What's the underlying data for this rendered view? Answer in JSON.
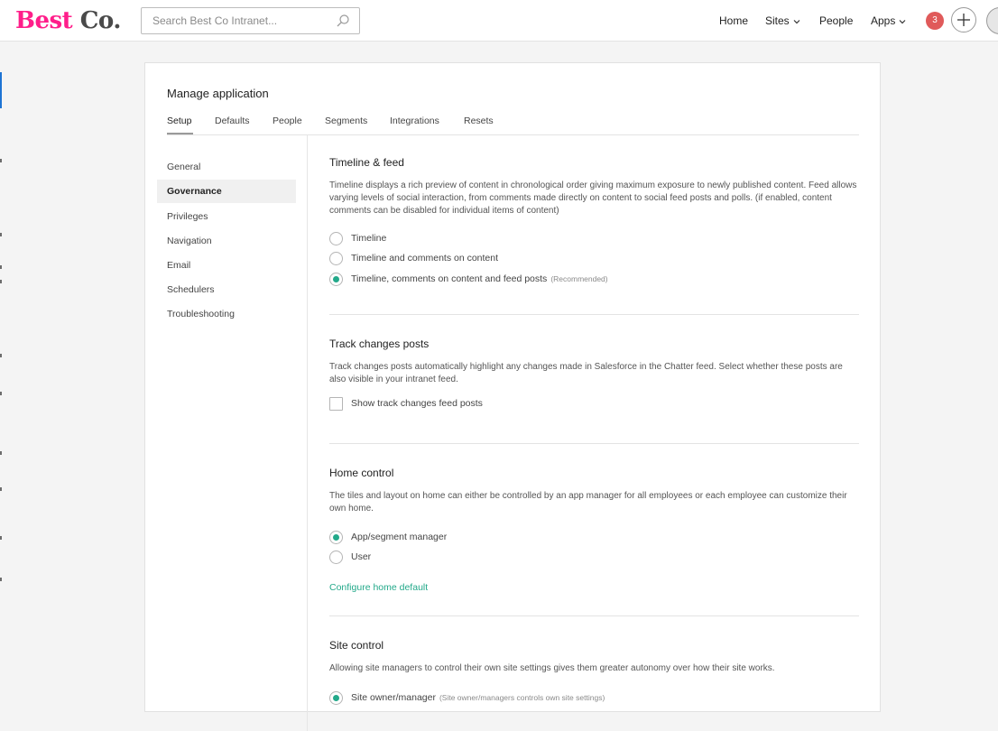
{
  "header": {
    "logo_part1": "Best",
    "logo_part2": "Co.",
    "search_placeholder": "Search Best Co Intranet...",
    "nav": {
      "home": "Home",
      "sites": "Sites",
      "people": "People",
      "apps": "Apps"
    },
    "notification_count": "3",
    "icons": [
      "search-icon",
      "chevron-down-icon",
      "plus-icon",
      "avatar"
    ]
  },
  "page": {
    "title": "Manage application",
    "tabs": [
      "Setup",
      "Defaults",
      "People",
      "Segments",
      "Integrations",
      "Resets"
    ],
    "active_tab": "Setup"
  },
  "sidebar": {
    "items": [
      "General",
      "Governance",
      "Privileges",
      "Navigation",
      "Email",
      "Schedulers",
      "Troubleshooting"
    ],
    "active": "Governance"
  },
  "sections": {
    "timeline": {
      "title": "Timeline & feed",
      "description": "Timeline displays a rich preview of content in chronological order giving maximum exposure to newly published content. Feed allows varying levels of social interaction, from comments made directly on content to social feed posts and polls. (if enabled, content comments can be disabled for individual items of content)",
      "options": [
        {
          "label": "Timeline",
          "note": "",
          "checked": false
        },
        {
          "label": "Timeline and comments on content",
          "note": "",
          "checked": false
        },
        {
          "label": "Timeline, comments on content and feed posts",
          "note": "(Recommended)",
          "checked": true
        }
      ]
    },
    "track_changes": {
      "title": "Track changes posts",
      "description": "Track changes posts automatically highlight any changes made in Salesforce in the Chatter feed. Select whether these posts are also visible in your intranet feed.",
      "checkbox_label": "Show track changes feed posts",
      "checkbox_checked": false
    },
    "home_control": {
      "title": "Home control",
      "description": "The tiles and layout on home can either be controlled by an app manager for all employees or each employee can customize their own home.",
      "options": [
        {
          "label": "App/segment manager",
          "checked": true
        },
        {
          "label": "User",
          "checked": false
        }
      ],
      "link": "Configure home default"
    },
    "site_control": {
      "title": "Site control",
      "description": "Allowing site managers to control their own site settings gives them greater autonomy over how their site works.",
      "options": [
        {
          "label": "Site owner/manager",
          "note": "(Site owner/managers controls own site settings)",
          "checked": true
        }
      ]
    }
  },
  "colors": {
    "accent": "#23a98a",
    "logo_pink": "#ff1e8a",
    "badge": "#e05a5a"
  }
}
